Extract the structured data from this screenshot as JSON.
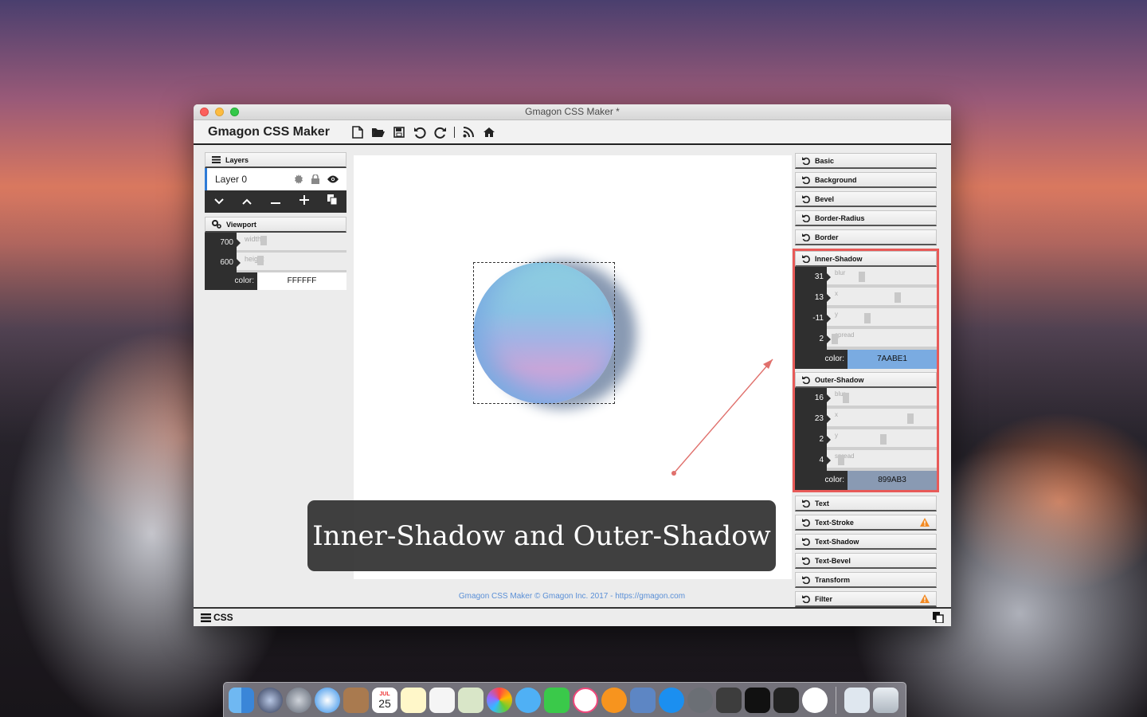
{
  "window": {
    "title": "Gmagon CSS Maker *"
  },
  "app": {
    "name": "Gmagon CSS Maker"
  },
  "toolbar": {
    "icons": [
      "new-file-icon",
      "open-folder-icon",
      "save-icon",
      "undo-icon",
      "redo-icon",
      "rss-icon",
      "home-icon"
    ]
  },
  "layers": {
    "title": "Layers",
    "items": [
      {
        "label": "Layer 0"
      }
    ]
  },
  "viewport": {
    "title": "Viewport",
    "width": "700",
    "width_label": "width",
    "height": "600",
    "height_label": "height",
    "color_label": "color:",
    "color": "FFFFFF"
  },
  "canvas": {
    "caption": "Inner-Shadow and Outer-Shadow",
    "footer": "Gmagon CSS Maker © Gmagon Inc. 2017 - https://gmagon.com"
  },
  "properties": {
    "basic": "Basic",
    "background": "Background",
    "bevel": "Bevel",
    "border_radius": "Border-Radius",
    "border": "Border",
    "inner_shadow": {
      "title": "Inner-Shadow",
      "blur": "31",
      "blur_label": "blur",
      "x": "13",
      "x_label": "x",
      "y": "-11",
      "y_label": "y",
      "spread": "2",
      "spread_label": "spread",
      "color_label": "color:",
      "color": "7AABE1",
      "color_hex": "#7AABE1"
    },
    "outer_shadow": {
      "title": "Outer-Shadow",
      "blur": "16",
      "blur_label": "blur",
      "x": "23",
      "x_label": "x",
      "y": "2",
      "y_label": "y",
      "spread": "4",
      "spread_label": "spread",
      "color_label": "color:",
      "color": "899AB3",
      "color_hex": "#899AB3"
    },
    "text": "Text",
    "text_stroke": "Text-Stroke",
    "text_shadow": "Text-Shadow",
    "text_bevel": "Text-Bevel",
    "transform": "Transform",
    "filter": "Filter"
  },
  "bottom": {
    "css_label": "CSS"
  },
  "dock": {
    "calendar_day": "25",
    "calendar_month": "JUL"
  },
  "colors": {
    "highlight": "#e85a58",
    "accent": "#2e7bd6"
  }
}
